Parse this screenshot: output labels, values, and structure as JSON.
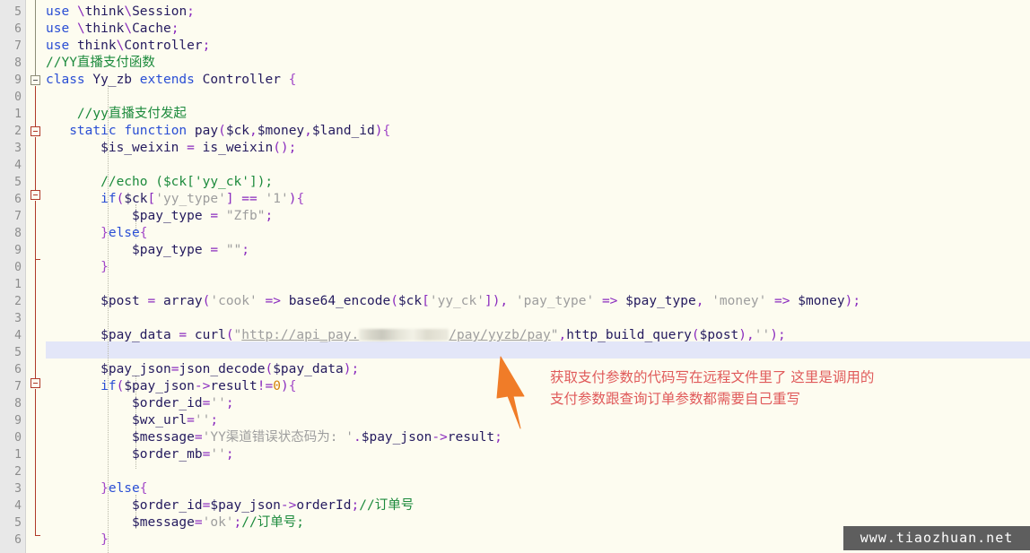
{
  "editor": {
    "title": "PHP source editor",
    "first_visible_line": 5,
    "last_visible_line": 46,
    "current_line": 35,
    "language": "PHP",
    "colors": {
      "background": "#fdfcf0",
      "gutter": "#e8e8e8",
      "current_line_highlight": "#e3e6f8",
      "keyword": "#2a4ed4",
      "identifier": "#241a5e",
      "comment": "#1c8a3c",
      "string": "#9e9e9e",
      "operator": "#8a2bbe",
      "number": "#d4820a",
      "fold_rail": "#b03a2a",
      "annotation": "#e05a5a",
      "arrow": "#f07c28",
      "watermark_bg": "#5e5e5e"
    }
  },
  "line_numbers": [
    "5",
    "6",
    "7",
    "8",
    "9",
    "0",
    "1",
    "2",
    "3",
    "4",
    "5",
    "6",
    "7",
    "8",
    "9",
    "0",
    "1",
    "2",
    "3",
    "4",
    "5",
    "6",
    "7",
    "8",
    "9",
    "0",
    "1",
    "2",
    "3",
    "4",
    "5",
    "6"
  ],
  "code_lines": [
    {
      "n": "5",
      "text": "use \\think\\Session;"
    },
    {
      "n": "6",
      "text": "use \\think\\Cache;"
    },
    {
      "n": "7",
      "text": "use think\\Controller;"
    },
    {
      "n": "8",
      "text": "//YY直播支付函数"
    },
    {
      "n": "9",
      "text": "class Yy_zb extends Controller {"
    },
    {
      "n": "0",
      "text": ""
    },
    {
      "n": "1",
      "text": "    //yy直播支付发起"
    },
    {
      "n": "2",
      "text": "    static function pay($ck,$money,$land_id){"
    },
    {
      "n": "3",
      "text": "        $is_weixin = is_weixin();"
    },
    {
      "n": "4",
      "text": ""
    },
    {
      "n": "5",
      "text": "        //echo ($ck['yy_ck']);"
    },
    {
      "n": "6",
      "text": "        if($ck['yy_type'] == '1'){"
    },
    {
      "n": "7",
      "text": "            $pay_type = \"Zfb\";"
    },
    {
      "n": "8",
      "text": "        }else{"
    },
    {
      "n": "9",
      "text": "            $pay_type = \"\";"
    },
    {
      "n": "0",
      "text": "        }"
    },
    {
      "n": "1",
      "text": ""
    },
    {
      "n": "2",
      "text": "        $post = array('cook' => base64_encode($ck['yy_ck']), 'pay_type' => $pay_type, 'money' => $money);"
    },
    {
      "n": "3",
      "text": ""
    },
    {
      "n": "4",
      "text": "        $pay_data = curl(\"http://api_pay.[REDACTED]/pay/yyzb/pay\",http_build_query($post),'');"
    },
    {
      "n": "5",
      "text": ""
    },
    {
      "n": "6",
      "text": "        $pay_json=json_decode($pay_data);"
    },
    {
      "n": "7",
      "text": "        if($pay_json->result!=0){"
    },
    {
      "n": "8",
      "text": "            $order_id='';"
    },
    {
      "n": "9",
      "text": "            $wx_url='';"
    },
    {
      "n": "0",
      "text": "            $message='YY渠道错误状态码为: '.$pay_json->result;"
    },
    {
      "n": "1",
      "text": "            $order_mb='';"
    },
    {
      "n": "2",
      "text": ""
    },
    {
      "n": "3",
      "text": "        }else{"
    },
    {
      "n": "4",
      "text": "            $order_id=$pay_json->orderId;//订单号"
    },
    {
      "n": "5",
      "text": "            $message='ok';//订单号;"
    },
    {
      "n": "6",
      "text": "        }"
    }
  ],
  "redaction": {
    "present": true,
    "on_line": "34",
    "description": "blurred domain segment in URL"
  },
  "annotation": {
    "line1": "获取支付参数的代码写在远程文件里了 这里是调用的",
    "line2": "支付参数跟查询订单参数都需要自己重写",
    "arrow": "up-left-arrow"
  },
  "watermark": {
    "text": "www.tiaozhuan.net"
  }
}
